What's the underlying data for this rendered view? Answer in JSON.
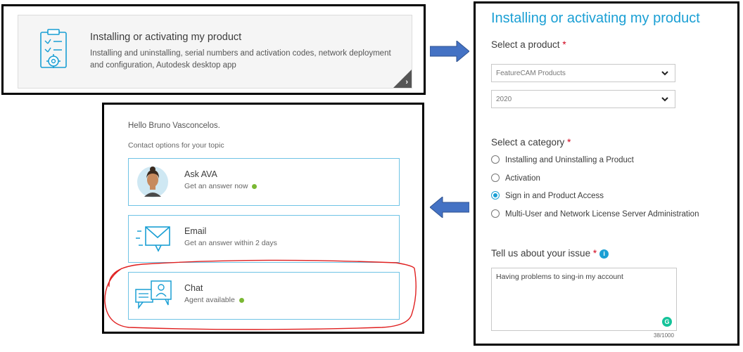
{
  "card": {
    "title": "Installing or activating my product",
    "description": "Installing and uninstalling, serial numbers and activation codes, network deployment and configuration, Autodesk desktop app",
    "icon": "clipboard-gear-icon"
  },
  "form": {
    "title": "Installing or activating my product",
    "product_label": "Select a product",
    "product_value": "FeatureCAM Products",
    "version_value": "2020",
    "category_label": "Select a category",
    "categories": [
      {
        "label": "Installing and Uninstalling a Product",
        "selected": false
      },
      {
        "label": "Activation",
        "selected": false
      },
      {
        "label": "Sign in and Product Access",
        "selected": true
      },
      {
        "label": "Multi-User and Network License Server Administration",
        "selected": false
      }
    ],
    "issue_label": "Tell us about your issue",
    "issue_text": "Having problems to sing-in my account",
    "counter": "38/1000",
    "required_mark": "*",
    "info_glyph": "i",
    "grammar_glyph": "G"
  },
  "contact": {
    "greeting": "Hello Bruno Vasconcelos.",
    "subtitle": "Contact options for your topic",
    "options": [
      {
        "title": "Ask AVA",
        "subtitle": "Get an answer now",
        "icon": "avatar-icon",
        "online": true
      },
      {
        "title": "Email",
        "subtitle": "Get an answer within 2 days",
        "icon": "envelope-icon",
        "online": false
      },
      {
        "title": "Chat",
        "subtitle": "Agent available",
        "icon": "chat-icon",
        "online": true
      }
    ]
  },
  "colors": {
    "accent": "#1a9fd4",
    "arrow": "#4472c4",
    "annotation": "#e02020",
    "online": "#7ab833"
  }
}
